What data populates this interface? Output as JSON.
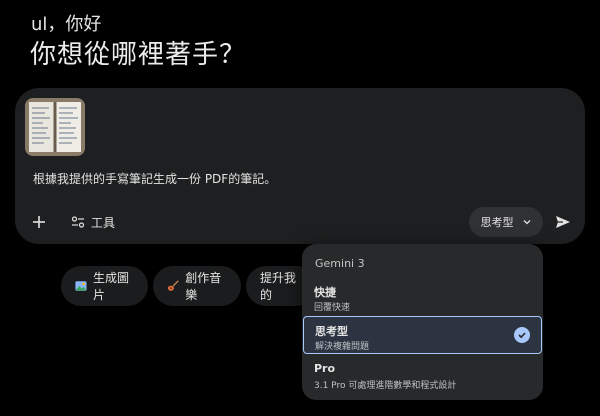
{
  "greeting": {
    "name_line": "ul，你好",
    "title": "你想從哪裡著手？"
  },
  "composer": {
    "attachment_icon": "notebook-photo-thumbnail",
    "prompt": "根據我提供的手寫筆記生成一份 PDF的筆記。",
    "tools_label": "工具",
    "model_label": "思考型",
    "send_icon": "send-icon"
  },
  "chips": [
    {
      "label": "生成圖片",
      "icon": "image-icon"
    },
    {
      "label": "創作音樂",
      "icon": "guitar-icon"
    },
    {
      "label": "提升我的",
      "icon": ""
    }
  ],
  "model_menu": {
    "header": "Gemini 3",
    "options": [
      {
        "title": "快捷",
        "desc": "回覆快速",
        "selected": false
      },
      {
        "title": "思考型",
        "desc": "解決複雜問題",
        "selected": true
      },
      {
        "title": "Pro",
        "desc": "3.1 Pro 可處理進階數學和程式設計",
        "selected": false
      }
    ]
  },
  "colors": {
    "background": "#000000",
    "panel": "#1e1f20",
    "menu": "#28292a",
    "accent": "#a8c7fa"
  }
}
